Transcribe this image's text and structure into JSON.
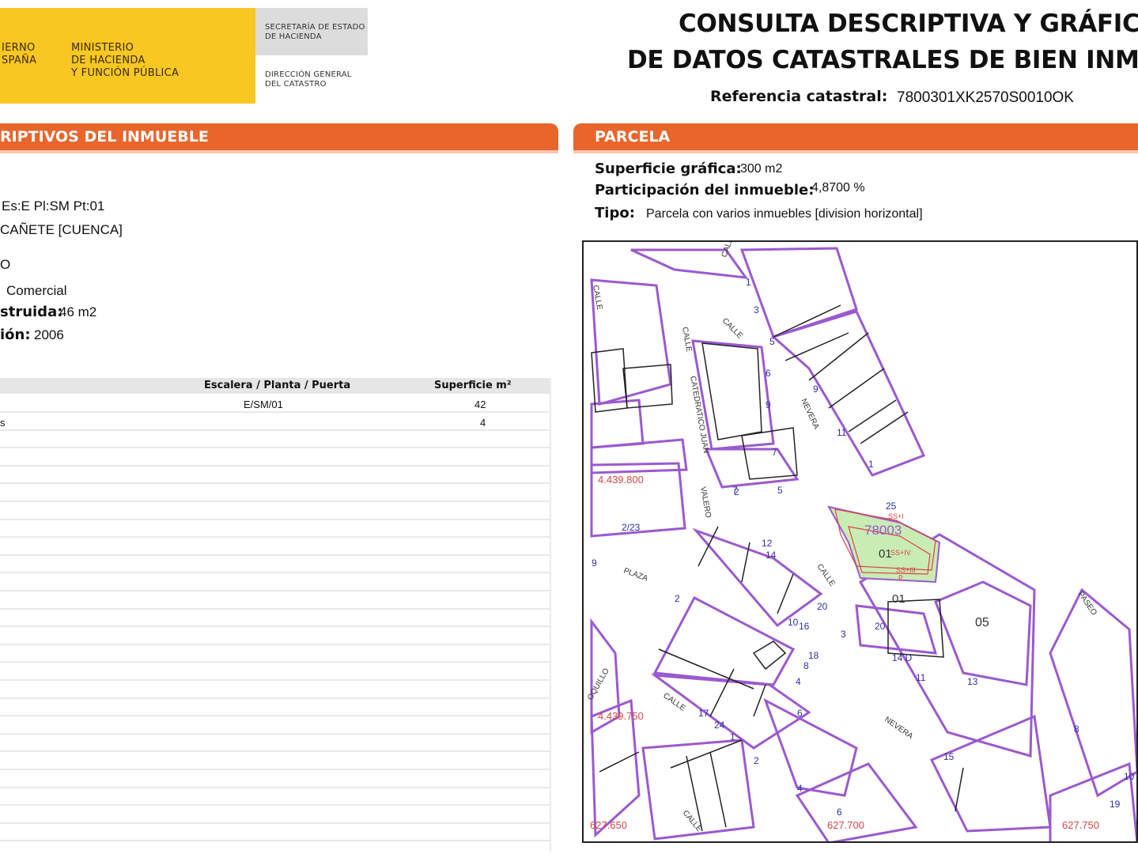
{
  "header": {
    "gov_line1": "IERNO",
    "gov_line2": "SPAÑA",
    "ministry_line1": "MINISTERIO",
    "ministry_line2": "DE HACIENDA",
    "ministry_line3": "Y FUNCIÓN PÚBLICA",
    "secretaria_line1": "SECRETARÍA DE ESTADO",
    "secretaria_line2": "DE HACIENDA",
    "direccion_line1": "DIRECCIÓN GENERAL",
    "direccion_line2": "DEL CATASTRO",
    "title_line1": "CONSULTA DESCRIPTIVA Y GRÁFICA",
    "title_line2": "DE DATOS CATASTRALES DE BIEN INMUEB",
    "ref_label": "Referencia catastral:",
    "ref_value": "7800301XK2570S0010OK"
  },
  "left": {
    "section_title": "RIPTIVOS DEL INMUEBLE",
    "address_line1": "Es:E Pl:SM Pt:01",
    "address_line2": "CAÑETE [CUENCA]",
    "clase_fragment": "O",
    "uso_value": "Comercial",
    "superficie_label": "struida:",
    "superficie_value": "46 m2",
    "anio_label": "ión:",
    "anio_value": "2006",
    "table": {
      "col_escalera": "Escalera / Planta / Puerta",
      "col_superficie": "Superficie m²",
      "rows": [
        {
          "uso": "",
          "escalera": "E/SM/01",
          "superficie": "42"
        },
        {
          "uso": "s",
          "escalera": "",
          "superficie": "4"
        }
      ]
    }
  },
  "right": {
    "section_title": "PARCELA",
    "superficie_label": "Superficie gráfica:",
    "superficie_value": "300 m2",
    "participacion_label": "Participación del inmueble:",
    "participacion_value": "4,8700 %",
    "tipo_label": "Tipo:",
    "tipo_value": "Parcela con varios inmuebles [division horizontal]"
  },
  "map": {
    "coord_labels": [
      "4.439.800",
      "4.439.750",
      "627.650",
      "627.700",
      "627.750"
    ],
    "street_labels": [
      "CALLE",
      "CALLE",
      "CALLE",
      "CALLE",
      "CATEDRATICO JUAN",
      "VALERO",
      "NEVERA",
      "PLAZA",
      "CALLE",
      "OQUILLO",
      "NEVERA",
      "PASEO",
      "CALLE",
      "CALLE"
    ],
    "parcel_labels": [
      "78003",
      "01",
      "01",
      "05"
    ],
    "floor_labels": [
      "SS+IV",
      "SS+III",
      "P",
      "SS+I"
    ],
    "numbers": [
      "1",
      "3",
      "5",
      "6",
      "9",
      "7",
      "2",
      "4",
      "6",
      "8",
      "10",
      "3",
      "5",
      "7",
      "9",
      "11",
      "1",
      "12",
      "14",
      "2",
      "16",
      "18",
      "20",
      "20",
      "14 D",
      "11",
      "13",
      "15",
      "17",
      "24",
      "1",
      "2",
      "4",
      "6",
      "8",
      "10",
      "19",
      "25",
      "2/23",
      "9",
      "1",
      "2/"
    ],
    "colors": {
      "parcel_line": "#9b59d0",
      "highlight_fill": "#c9ecb4",
      "coord_text": "#d94545",
      "number_text": "#2f2fa8"
    }
  }
}
